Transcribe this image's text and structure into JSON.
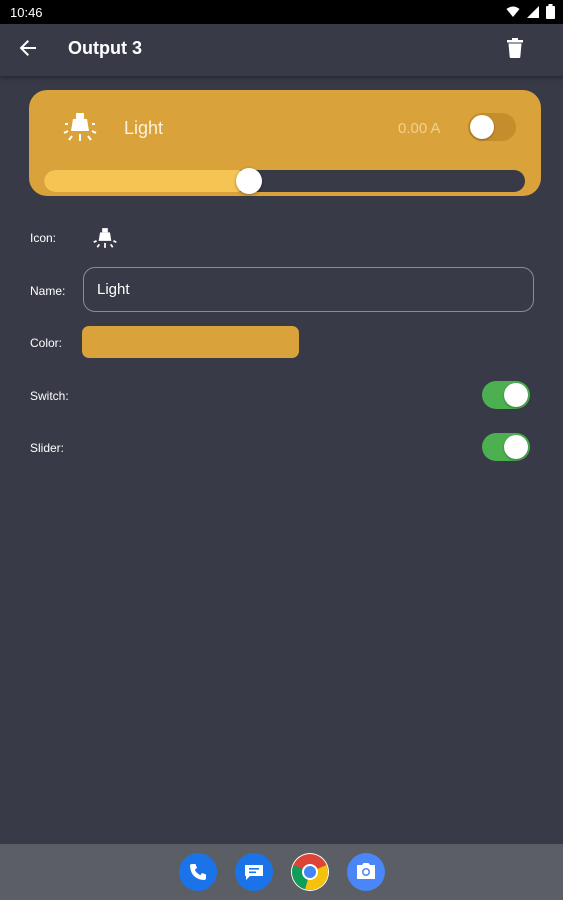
{
  "status_bar": {
    "time": "10:46",
    "icons": [
      "wifi-icon",
      "signal-icon",
      "battery-icon"
    ]
  },
  "app_bar": {
    "title": "Output 3",
    "back_icon": "arrow-back-icon",
    "delete_icon": "trash-icon"
  },
  "output_card": {
    "icon": "light-bulb-icon",
    "name": "Light",
    "current": "0.00 A",
    "switch_on": false,
    "slider_level": 0.4,
    "color": "#d9a23a"
  },
  "form": {
    "icon_label": "Icon:",
    "icon": "light-bulb-icon",
    "name_label": "Name:",
    "name_value": "Light",
    "color_label": "Color:",
    "color_value": "#d9a23a",
    "switch_label": "Switch:",
    "switch_enabled": true,
    "slider_label": "Slider:",
    "slider_enabled": true
  },
  "nav_bar": {
    "apps": [
      "phone-icon",
      "messages-icon",
      "chrome-icon",
      "camera-icon"
    ]
  },
  "colors": {
    "background": "#383a48",
    "accent": "#d9a23a",
    "toggle_on": "#4caf50"
  }
}
